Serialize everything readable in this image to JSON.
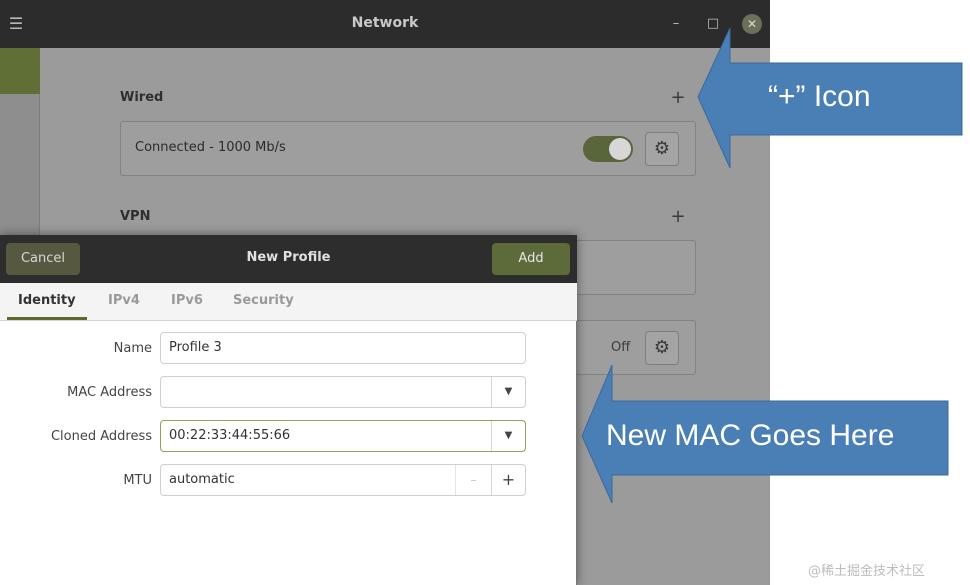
{
  "window": {
    "title": "Network",
    "menu_icon": "hamburger-menu-icon",
    "minimize_glyph": "–",
    "maximize_glyph": "□",
    "close_glyph": "✕"
  },
  "wired": {
    "heading": "Wired",
    "add_glyph": "+",
    "connection_label": "Connected - 1000 Mb/s",
    "toggle_on": true,
    "settings_icon": "gear-icon"
  },
  "vpn": {
    "heading": "VPN",
    "add_glyph": "+"
  },
  "other": {
    "status": "Off",
    "settings_icon": "gear-icon"
  },
  "dialog": {
    "title": "New Profile",
    "cancel_label": "Cancel",
    "add_label": "Add",
    "tabs": [
      {
        "label": "Identity",
        "active": true
      },
      {
        "label": "IPv4",
        "active": false
      },
      {
        "label": "IPv6",
        "active": false
      },
      {
        "label": "Security",
        "active": false
      }
    ],
    "fields": {
      "name": {
        "label": "Name",
        "value": "Profile 3"
      },
      "mac": {
        "label": "MAC Address",
        "value": ""
      },
      "cloned": {
        "label": "Cloned Address",
        "value": "00:22:33:44:55:66"
      },
      "mtu": {
        "label": "MTU",
        "value": "automatic",
        "minus_glyph": "–",
        "plus_glyph": "+"
      }
    }
  },
  "annotations": {
    "plus_icon_callout": "“+” Icon",
    "mac_callout": "New MAC Goes Here",
    "arrow_color": "#4a7fb5"
  },
  "watermark": "@稀土掘金技术社区",
  "colors": {
    "accent": "#5d6a3a",
    "titlebar": "#2c2c2c"
  }
}
